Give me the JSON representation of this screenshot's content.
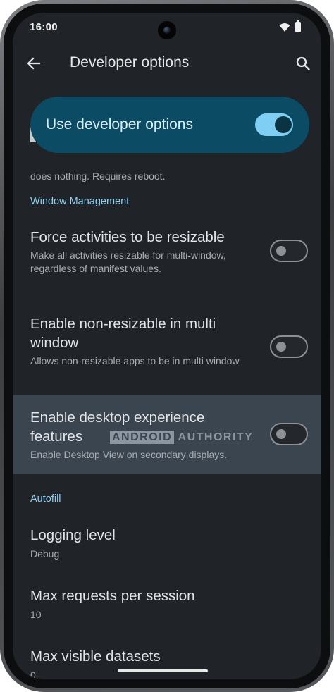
{
  "status_bar": {
    "time": "16:00",
    "wifi_icon": "wifi-icon",
    "battery_icon": "battery-icon"
  },
  "app_bar": {
    "title": "Developer options",
    "back_icon": "arrow-left-icon",
    "search_icon": "search-icon"
  },
  "master_switch": {
    "label": "Use developer options",
    "on": true
  },
  "hidden_pref_summary": "does nothing. Requires reboot.",
  "sections": {
    "window_management": "Window Management",
    "autofill": "Autofill"
  },
  "prefs": [
    {
      "title": "Force activities to be resizable",
      "summary": "Make all activities resizable for multi-window, regardless of manifest values.",
      "on": false
    },
    {
      "title": "Enable non-resizable in multi window",
      "summary": "Allows non-resizable apps to be in multi window",
      "on": false
    },
    {
      "title": "Enable desktop experience features",
      "summary": "Enable Desktop View on secondary displays.",
      "on": false,
      "highlighted": true
    }
  ],
  "autofill_prefs": [
    {
      "title": "Logging level",
      "summary": "Debug"
    },
    {
      "title": "Max requests per session",
      "summary": "10"
    },
    {
      "title": "Max visible datasets",
      "summary": "0"
    }
  ],
  "watermark": {
    "boxed": "ANDROID",
    "rest": "AUTHORITY"
  },
  "colors": {
    "background": "#202327",
    "accent": "#7ecff3",
    "master_card": "#0b4b63",
    "highlight_row": "#3a4550",
    "section_header": "#8fd0f2"
  }
}
